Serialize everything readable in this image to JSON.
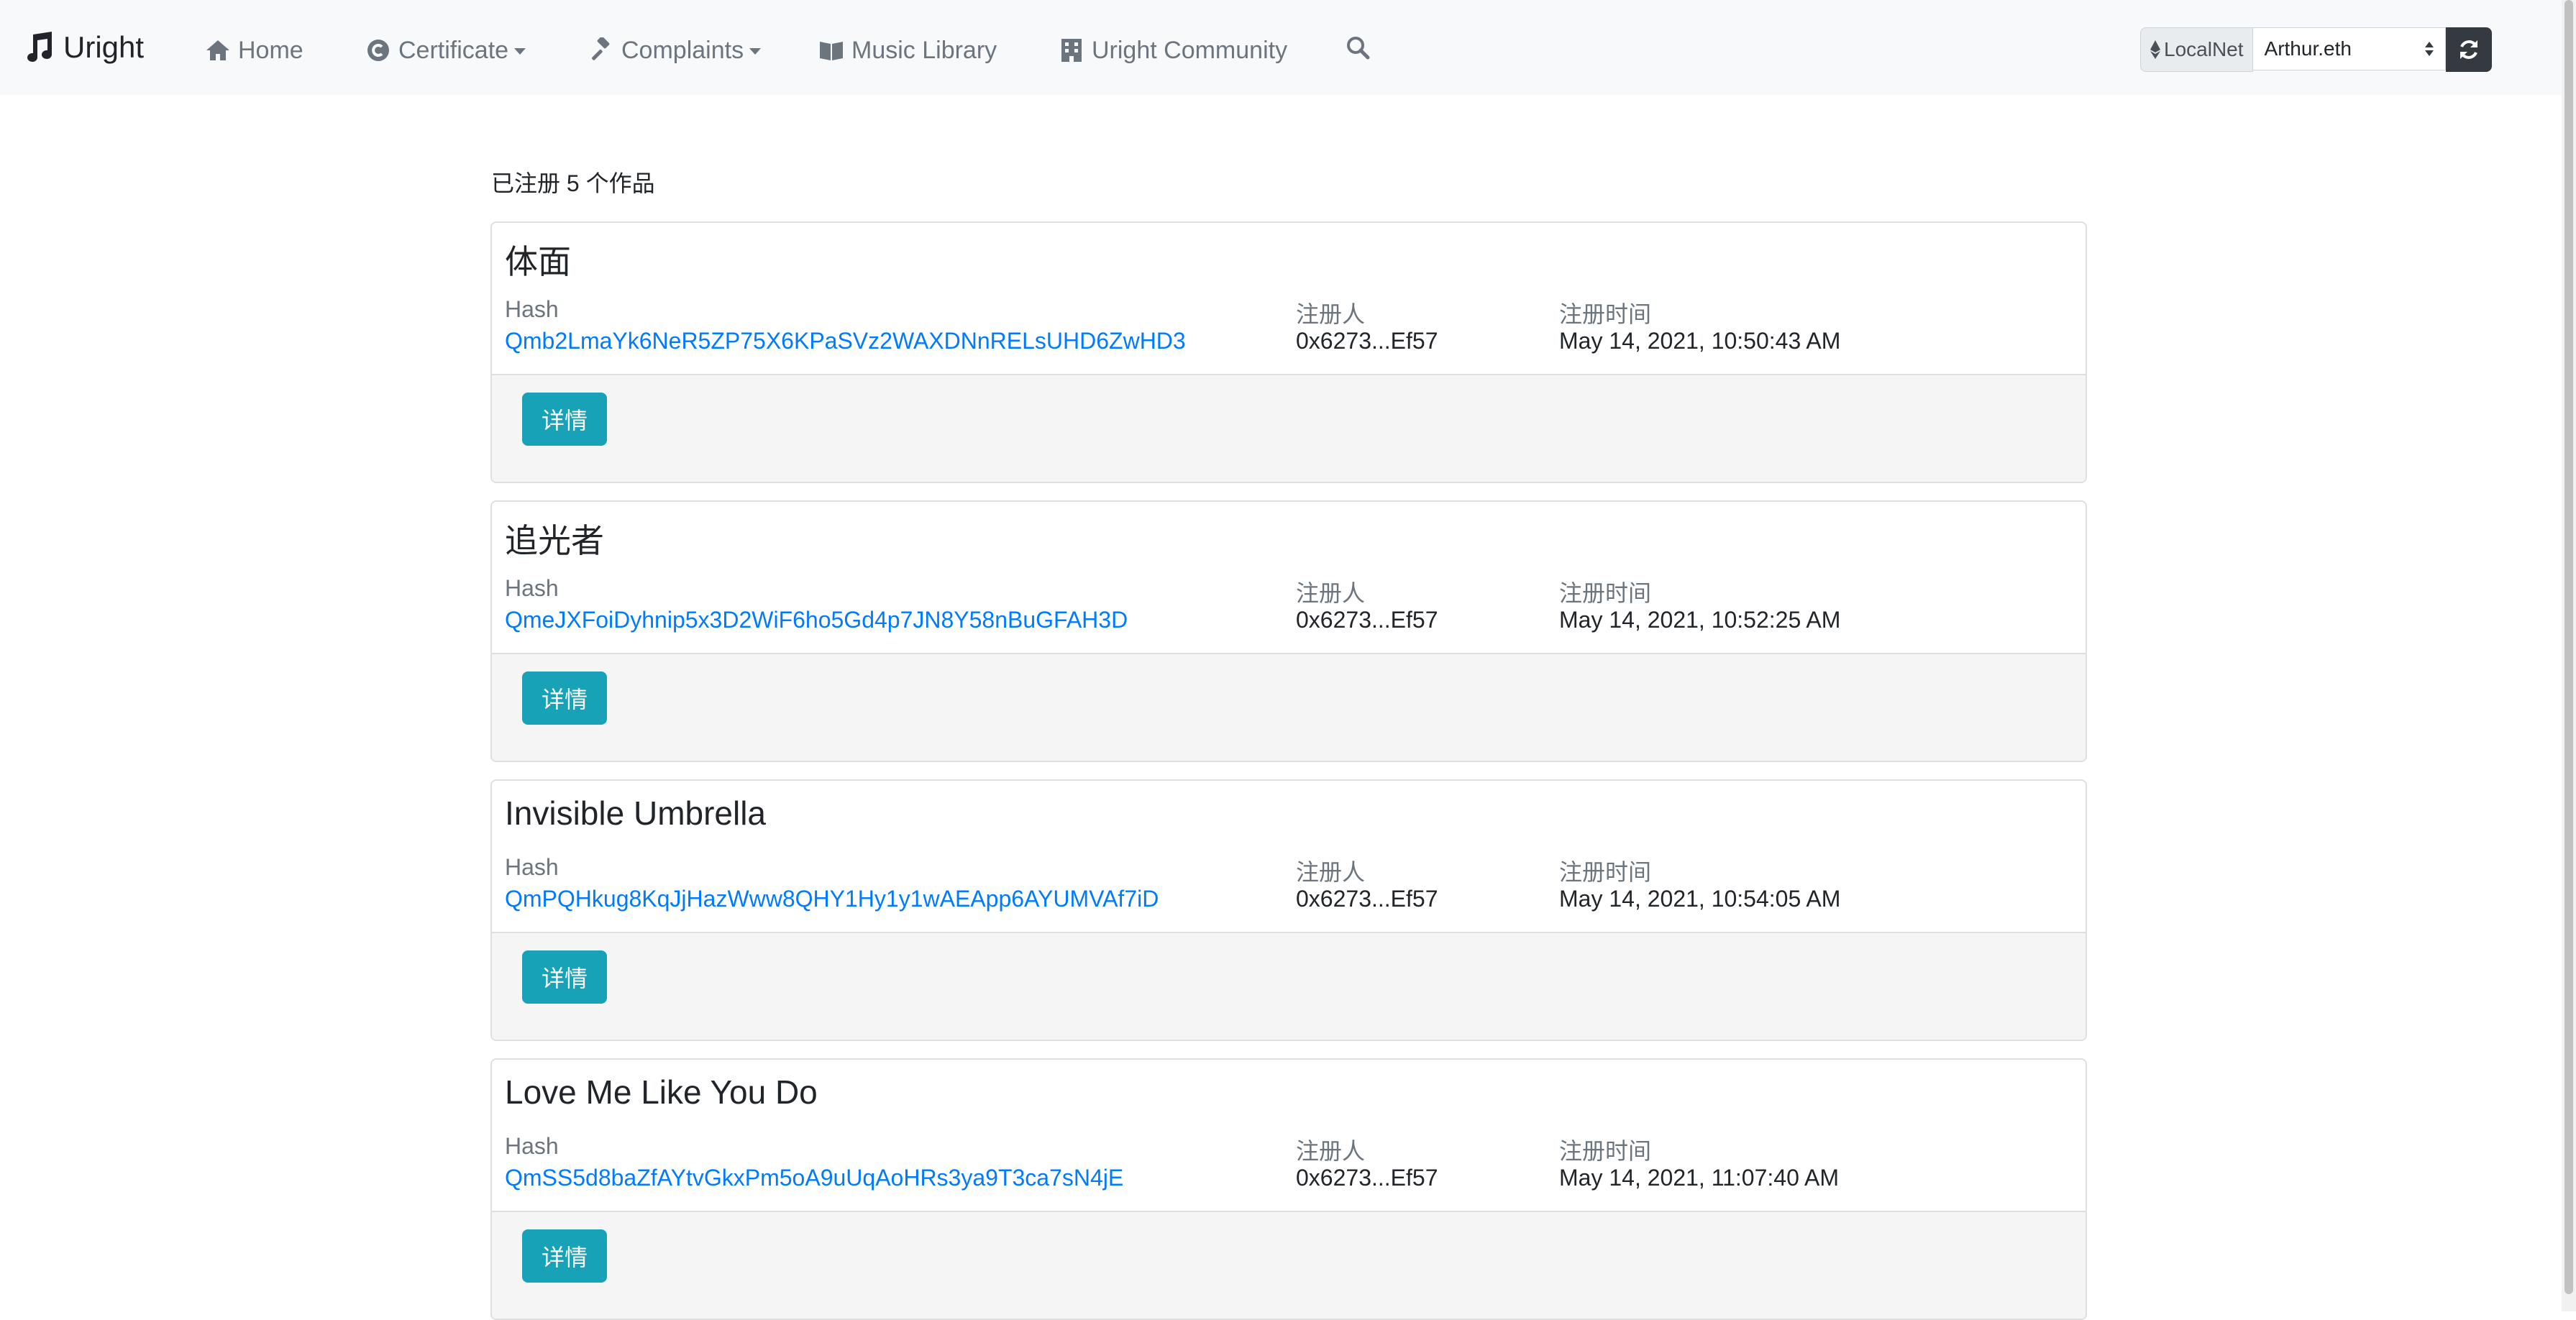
{
  "navbar": {
    "brand": "Uright",
    "items": [
      {
        "label": "Home",
        "icon": "home-icon"
      },
      {
        "label": "Certificate",
        "icon": "copyright-icon",
        "dropdown": true
      },
      {
        "label": "Complaints",
        "icon": "gavel-icon",
        "dropdown": true
      },
      {
        "label": "Music Library",
        "icon": "book-icon"
      },
      {
        "label": "Uright Community",
        "icon": "building-icon"
      }
    ],
    "search_icon": "search-icon",
    "network_label": "LocalNet",
    "account": "Arthur.eth",
    "refresh_icon": "refresh-icon"
  },
  "main": {
    "count_text": "已注册 5 个作品",
    "labels": {
      "hash": "Hash",
      "registrant": "注册人",
      "time": "注册时间",
      "detail_button": "详情"
    },
    "works": [
      {
        "title": "体面",
        "hash": "Qmb2LmaYk6NeR5ZP75X6KPaSVz2WAXDNnRELsUHD6ZwHD3",
        "registrant": "0x6273...Ef57",
        "time": "May 14, 2021, 10:50:43 AM"
      },
      {
        "title": "追光者",
        "hash": "QmeJXFoiDyhnip5x3D2WiF6ho5Gd4p7JN8Y58nBuGFAH3D",
        "registrant": "0x6273...Ef57",
        "time": "May 14, 2021, 10:52:25 AM"
      },
      {
        "title": "Invisible Umbrella",
        "hash": "QmPQHkug8KqJjHazWww8QHY1Hy1y1wAEApp6AYUMVAf7iD",
        "registrant": "0x6273...Ef57",
        "time": "May 14, 2021, 10:54:05 AM"
      },
      {
        "title": "Love Me Like You Do",
        "hash": "QmSS5d8baZfAYtvGkxPm5oA9uUqAoHRs3ya9T3ca7sN4jE",
        "registrant": "0x6273...Ef57",
        "time": "May 14, 2021, 11:07:40 AM"
      }
    ]
  },
  "colors": {
    "navbar_bg": "#f8f9fa",
    "link": "#007bff",
    "info_button": "#17a2b8",
    "dark_button": "#343a40"
  }
}
